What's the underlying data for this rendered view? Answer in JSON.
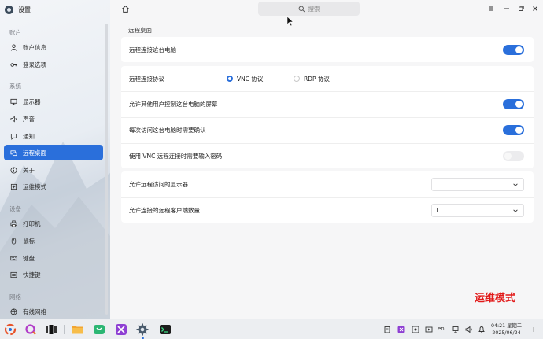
{
  "app": {
    "title": "设置"
  },
  "sidebar": {
    "sections": [
      {
        "label": "账户",
        "items": [
          {
            "label": "账户信息",
            "icon": "user-icon"
          },
          {
            "label": "登录选项",
            "icon": "key-icon"
          }
        ]
      },
      {
        "label": "系统",
        "items": [
          {
            "label": "显示器",
            "icon": "monitor-icon"
          },
          {
            "label": "声音",
            "icon": "speaker-icon"
          },
          {
            "label": "通知",
            "icon": "notification-icon"
          },
          {
            "label": "远程桌面",
            "icon": "remote-desktop-icon",
            "active": true
          },
          {
            "label": "关于",
            "icon": "info-icon"
          },
          {
            "label": "运维模式",
            "icon": "maintenance-icon"
          }
        ]
      },
      {
        "label": "设备",
        "items": [
          {
            "label": "打印机",
            "icon": "printer-icon"
          },
          {
            "label": "鼠标",
            "icon": "mouse-icon"
          },
          {
            "label": "键盘",
            "icon": "keyboard-icon"
          },
          {
            "label": "快捷键",
            "icon": "shortcut-icon"
          }
        ]
      },
      {
        "label": "网络",
        "items": [
          {
            "label": "有线网络",
            "icon": "wired-network-icon"
          }
        ]
      }
    ]
  },
  "search": {
    "placeholder": "搜索"
  },
  "page": {
    "title": "远程桌面",
    "remote_connect": {
      "label": "远程连接这台电脑",
      "enabled": true
    },
    "protocol": {
      "label": "远程连接协议",
      "options": [
        "VNC 协议",
        "RDP 协议"
      ],
      "selected": "VNC 协议"
    },
    "allow_control": {
      "label": "允许其他用户控制这台电脑的屏幕",
      "enabled": true
    },
    "confirm_each": {
      "label": "每次访问这台电脑时需要确认",
      "enabled": true
    },
    "vnc_password": {
      "label": "使用 VNC 远程连接时需要输入密码:",
      "enabled": false
    },
    "allowed_display": {
      "label": "允许远程访问的显示器",
      "value": ""
    },
    "client_count": {
      "label": "允许连接的远程客户端数量",
      "value": "1"
    }
  },
  "watermark": "运维模式",
  "taskbar": {
    "clock": {
      "time": "04:21 星期二",
      "date": "2025/06/24"
    },
    "lang": "en"
  },
  "colors": {
    "accent": "#2a6fdb",
    "watermark": "#e21a1a"
  }
}
